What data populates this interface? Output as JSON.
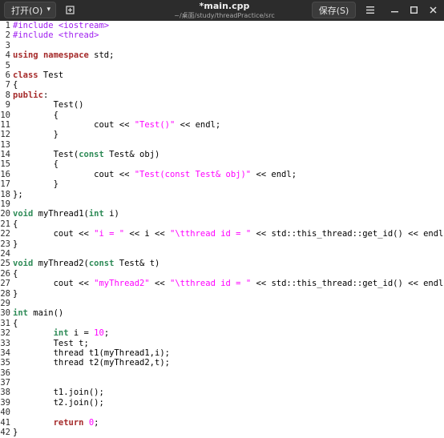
{
  "header": {
    "open_label": "打开(O)",
    "dropdown_icon": "▾",
    "title": "*main.cpp",
    "subtitle": "~/桌面/study/threadPractice/src",
    "save_label": "保存(S)"
  },
  "colors": {
    "header_bg": "#2c2c2c",
    "preprocessor": "#a020f0",
    "keyword": "#a52a2a",
    "type": "#2e8b57",
    "string": "#ff00ff"
  },
  "lines": [
    {
      "n": "1",
      "tokens": [
        {
          "t": "pre",
          "s": "#include <iostream>"
        }
      ]
    },
    {
      "n": "2",
      "tokens": [
        {
          "t": "pre",
          "s": "#include <thread>"
        }
      ]
    },
    {
      "n": "3",
      "tokens": []
    },
    {
      "n": "4",
      "tokens": [
        {
          "t": "kw",
          "s": "using"
        },
        {
          "t": "txt",
          "s": " "
        },
        {
          "t": "kw",
          "s": "namespace"
        },
        {
          "t": "txt",
          "s": " std;"
        }
      ]
    },
    {
      "n": "5",
      "tokens": []
    },
    {
      "n": "6",
      "tokens": [
        {
          "t": "kw",
          "s": "class"
        },
        {
          "t": "txt",
          "s": " Test"
        }
      ]
    },
    {
      "n": "7",
      "tokens": [
        {
          "t": "txt",
          "s": "{"
        }
      ]
    },
    {
      "n": "8",
      "tokens": [
        {
          "t": "kw",
          "s": "public"
        },
        {
          "t": "txt",
          "s": ":"
        }
      ]
    },
    {
      "n": "9",
      "tokens": [
        {
          "t": "txt",
          "s": "        Test()"
        }
      ]
    },
    {
      "n": "10",
      "tokens": [
        {
          "t": "txt",
          "s": "        {"
        }
      ]
    },
    {
      "n": "11",
      "tokens": [
        {
          "t": "txt",
          "s": "                cout << "
        },
        {
          "t": "str",
          "s": "\"Test()\""
        },
        {
          "t": "txt",
          "s": " << endl;"
        }
      ]
    },
    {
      "n": "12",
      "tokens": [
        {
          "t": "txt",
          "s": "        }"
        }
      ]
    },
    {
      "n": "13",
      "tokens": []
    },
    {
      "n": "14",
      "tokens": [
        {
          "t": "txt",
          "s": "        Test("
        },
        {
          "t": "ty",
          "s": "const"
        },
        {
          "t": "txt",
          "s": " Test& obj)"
        }
      ]
    },
    {
      "n": "15",
      "tokens": [
        {
          "t": "txt",
          "s": "        {"
        }
      ]
    },
    {
      "n": "16",
      "tokens": [
        {
          "t": "txt",
          "s": "                cout << "
        },
        {
          "t": "str",
          "s": "\"Test(const Test& obj)\""
        },
        {
          "t": "txt",
          "s": " << endl;"
        }
      ]
    },
    {
      "n": "17",
      "tokens": [
        {
          "t": "txt",
          "s": "        }"
        }
      ]
    },
    {
      "n": "18",
      "tokens": [
        {
          "t": "txt",
          "s": "};"
        }
      ]
    },
    {
      "n": "19",
      "tokens": []
    },
    {
      "n": "20",
      "tokens": [
        {
          "t": "ty",
          "s": "void"
        },
        {
          "t": "txt",
          "s": " myThread1("
        },
        {
          "t": "ty",
          "s": "int"
        },
        {
          "t": "txt",
          "s": " i)"
        }
      ]
    },
    {
      "n": "21",
      "tokens": [
        {
          "t": "txt",
          "s": "{"
        }
      ]
    },
    {
      "n": "22",
      "tokens": [
        {
          "t": "txt",
          "s": "        cout << "
        },
        {
          "t": "str",
          "s": "\"i = \""
        },
        {
          "t": "txt",
          "s": " << i << "
        },
        {
          "t": "str",
          "s": "\"\\tthread id = \""
        },
        {
          "t": "txt",
          "s": " << std::this_thread::get_id() << endl;"
        }
      ]
    },
    {
      "n": "23",
      "tokens": [
        {
          "t": "txt",
          "s": "}"
        }
      ]
    },
    {
      "n": "24",
      "tokens": []
    },
    {
      "n": "25",
      "tokens": [
        {
          "t": "ty",
          "s": "void"
        },
        {
          "t": "txt",
          "s": " myThread2("
        },
        {
          "t": "ty",
          "s": "const"
        },
        {
          "t": "txt",
          "s": " Test& t)"
        }
      ]
    },
    {
      "n": "26",
      "tokens": [
        {
          "t": "txt",
          "s": "{"
        }
      ]
    },
    {
      "n": "27",
      "tokens": [
        {
          "t": "txt",
          "s": "        cout << "
        },
        {
          "t": "str",
          "s": "\"myThread2\""
        },
        {
          "t": "txt",
          "s": " << "
        },
        {
          "t": "str",
          "s": "\"\\tthread id = \""
        },
        {
          "t": "txt",
          "s": " << std::this_thread::get_id() << endl;"
        }
      ]
    },
    {
      "n": "28",
      "tokens": [
        {
          "t": "txt",
          "s": "}"
        }
      ]
    },
    {
      "n": "29",
      "tokens": []
    },
    {
      "n": "30",
      "tokens": [
        {
          "t": "ty",
          "s": "int"
        },
        {
          "t": "txt",
          "s": " main()"
        }
      ]
    },
    {
      "n": "31",
      "tokens": [
        {
          "t": "txt",
          "s": "{"
        }
      ]
    },
    {
      "n": "32",
      "tokens": [
        {
          "t": "txt",
          "s": "        "
        },
        {
          "t": "ty",
          "s": "int"
        },
        {
          "t": "txt",
          "s": " i = "
        },
        {
          "t": "num",
          "s": "10"
        },
        {
          "t": "txt",
          "s": ";"
        }
      ]
    },
    {
      "n": "33",
      "tokens": [
        {
          "t": "txt",
          "s": "        Test t;"
        }
      ]
    },
    {
      "n": "34",
      "tokens": [
        {
          "t": "txt",
          "s": "        thread t1(myThread1,i);"
        }
      ]
    },
    {
      "n": "35",
      "tokens": [
        {
          "t": "txt",
          "s": "        thread t2(myThread2,t);"
        }
      ]
    },
    {
      "n": "36",
      "tokens": []
    },
    {
      "n": "37",
      "tokens": []
    },
    {
      "n": "38",
      "tokens": [
        {
          "t": "txt",
          "s": "        t1.join();"
        }
      ]
    },
    {
      "n": "39",
      "tokens": [
        {
          "t": "txt",
          "s": "        t2.join();"
        }
      ]
    },
    {
      "n": "40",
      "tokens": []
    },
    {
      "n": "41",
      "tokens": [
        {
          "t": "txt",
          "s": "        "
        },
        {
          "t": "kw",
          "s": "return"
        },
        {
          "t": "txt",
          "s": " "
        },
        {
          "t": "num",
          "s": "0"
        },
        {
          "t": "txt",
          "s": ";"
        }
      ]
    },
    {
      "n": "42",
      "tokens": [
        {
          "t": "txt",
          "s": "}"
        }
      ]
    }
  ]
}
